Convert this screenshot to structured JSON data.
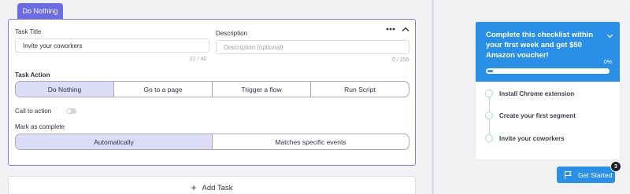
{
  "editor": {
    "tab_label": "Do Nothing",
    "task_title": {
      "label": "Task Title",
      "value": "Invite your coworkers",
      "count": "21 / 40"
    },
    "description": {
      "label": "Description",
      "placeholder": "Description (optional)",
      "count": "0 / 255"
    },
    "menu_icon": "more-horizontal-icon",
    "collapse_icon": "chevron-up-icon",
    "task_action": {
      "label": "Task Action",
      "options": [
        "Do Nothing",
        "Go to a page",
        "Trigger a flow",
        "Run Script"
      ],
      "selected": "Do Nothing"
    },
    "call_to_action": {
      "label": "Call to action",
      "enabled": false
    },
    "mark_complete": {
      "label": "Mark as complete",
      "options": [
        "Automatically",
        "Matches specific events"
      ],
      "selected": "Automatically"
    },
    "add_task_label": "Add Task"
  },
  "preview": {
    "title": "Complete this checklist within your first week and get $50 Amazon voucher!",
    "progress_label": "0%",
    "progress": 0,
    "steps": [
      "Install Chrome extension",
      "Create your first segment",
      "Invite your coworkers"
    ],
    "launcher": {
      "label": "Get Started",
      "badge": "3",
      "icon": "flag-icon"
    }
  },
  "colors": {
    "accent": "#6b6be6",
    "selected_option": "#dcdcf7",
    "widget_blue": "#2a8fe6",
    "step_circle": "#a8dcc9"
  }
}
